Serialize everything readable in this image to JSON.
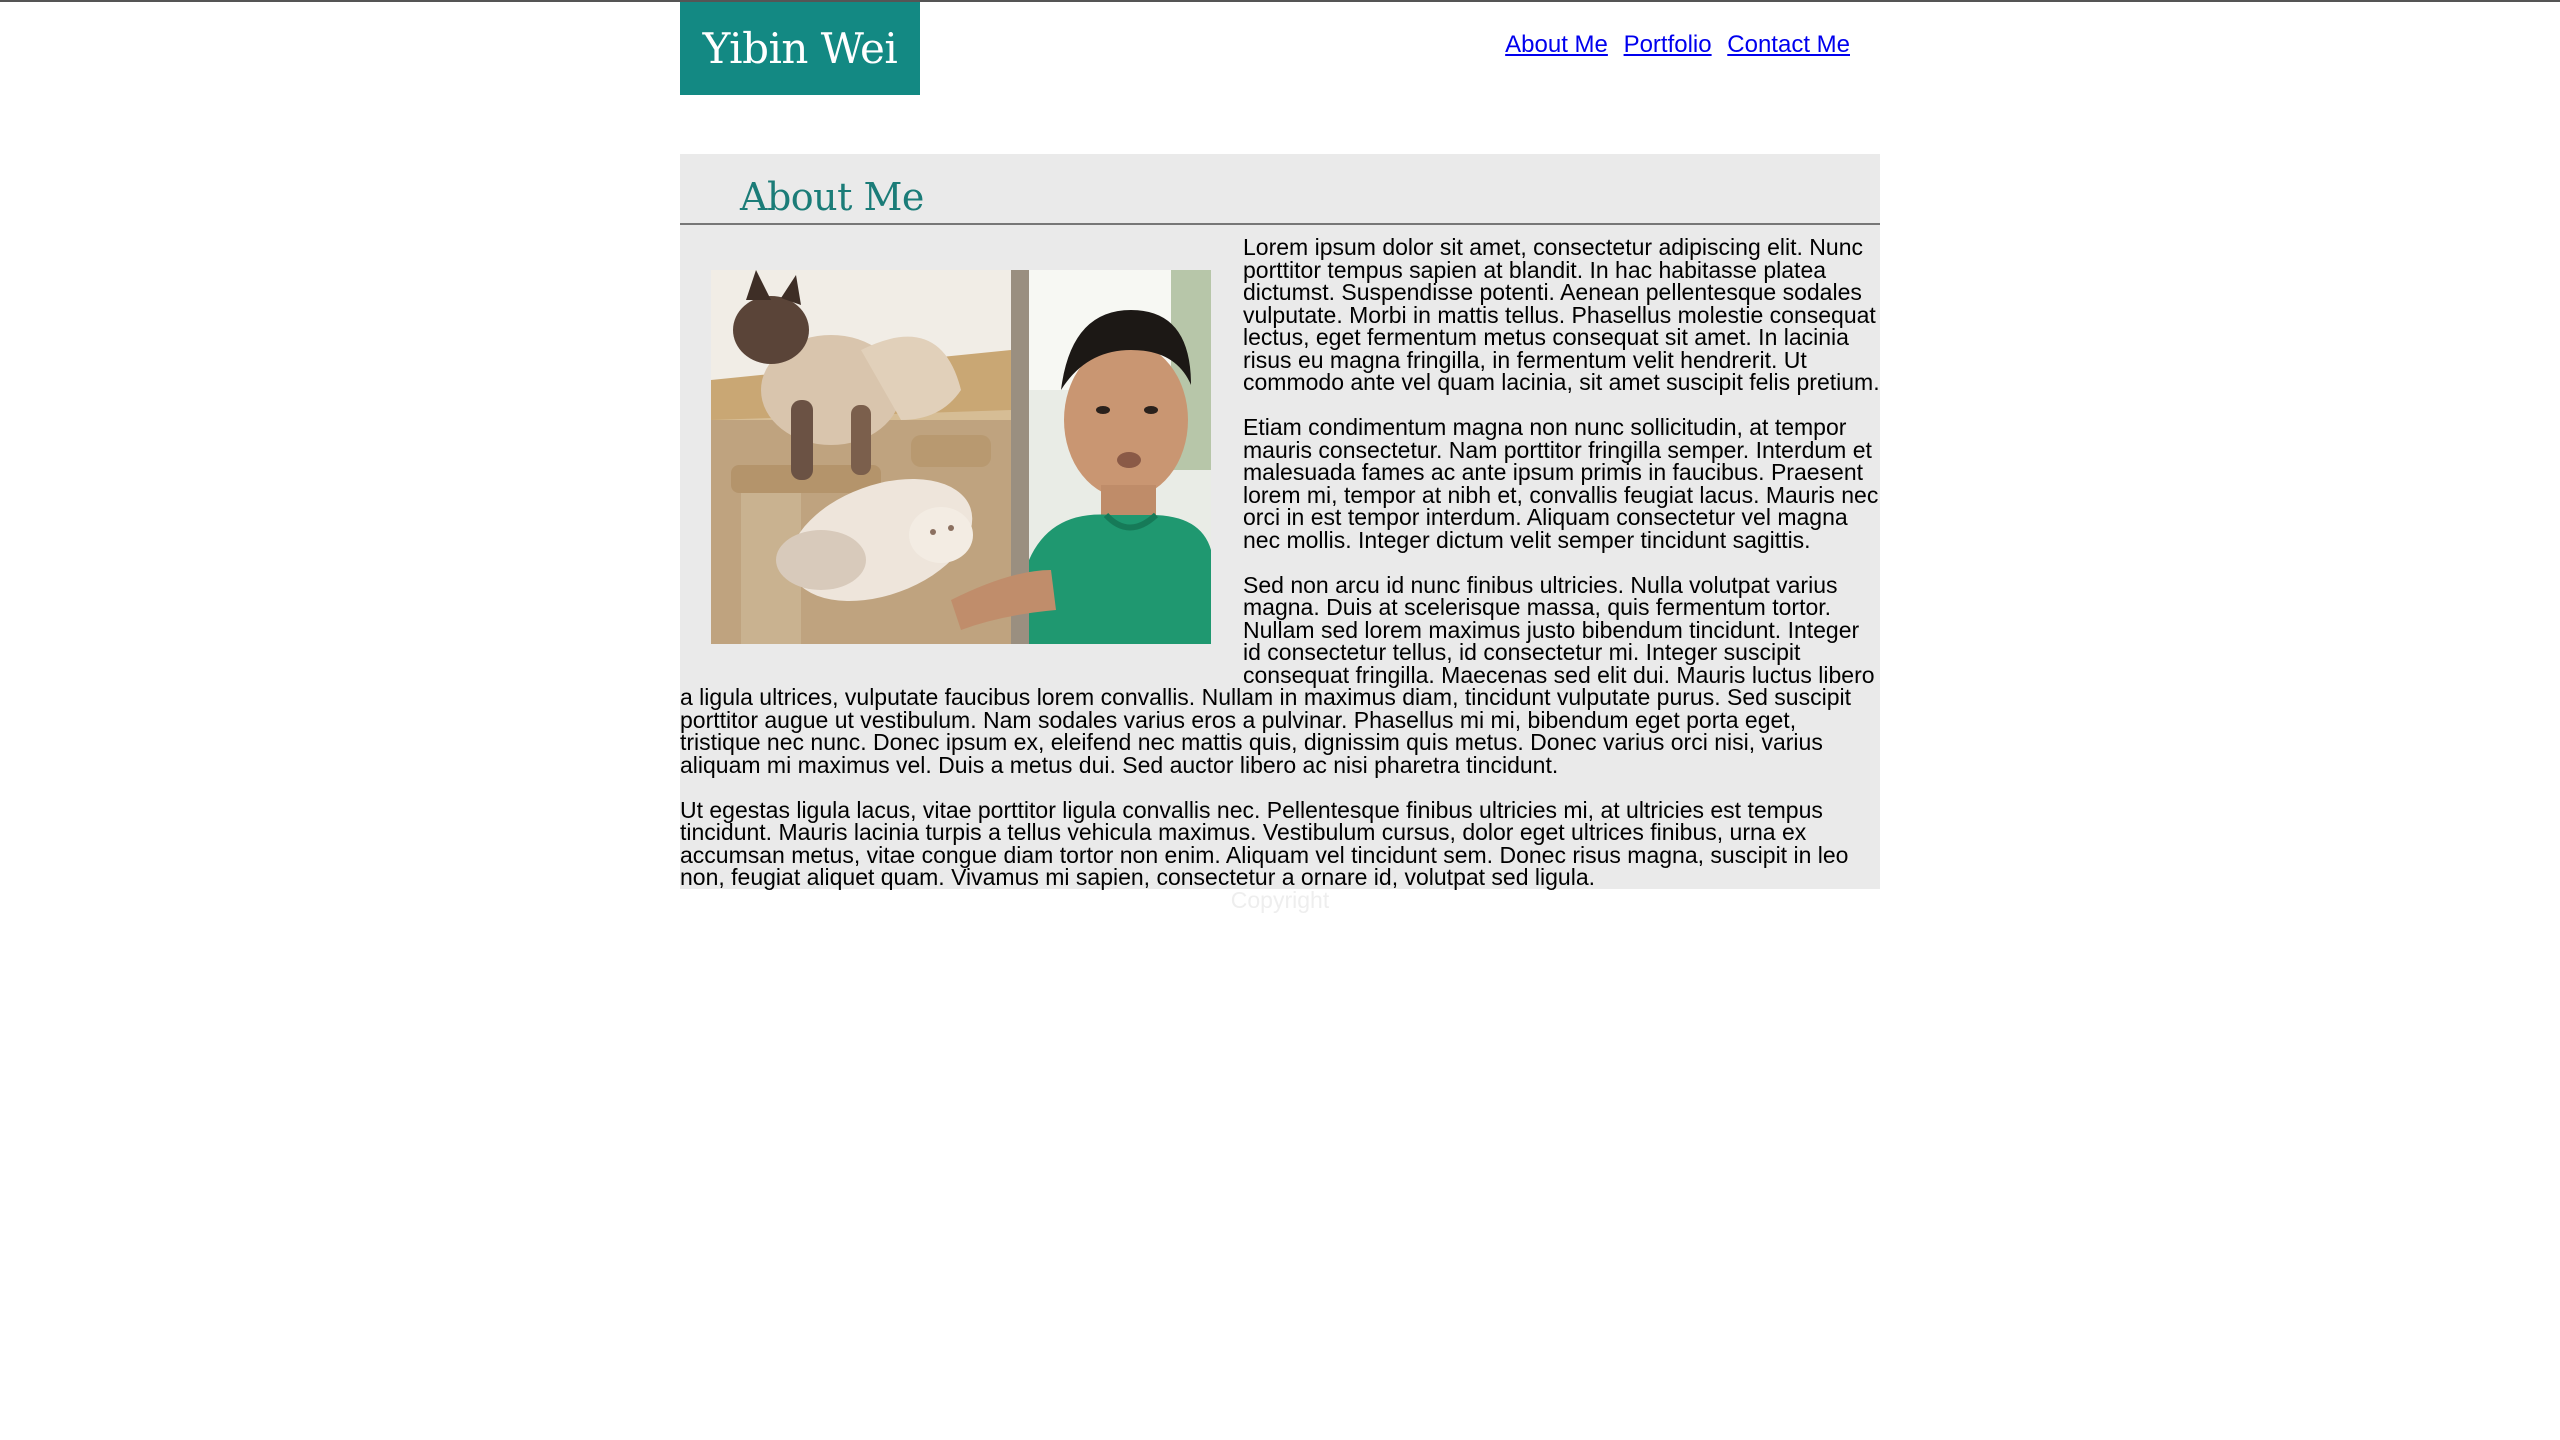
{
  "site": {
    "brand": "Yibin Wei"
  },
  "nav": {
    "items": [
      "About Me",
      "Portfolio",
      "Contact Me"
    ]
  },
  "about": {
    "title": "About Me",
    "paragraphs": [
      "Lorem ipsum dolor sit amet, consectetur adipiscing elit. Nunc porttitor tempus sapien at blandit. In hac habitasse platea dictumst. Suspendisse potenti. Aenean pellentesque sodales vulputate. Morbi in mattis tellus. Phasellus molestie consequat lectus, eget fermentum metus consequat sit amet. In lacinia risus eu magna fringilla, in fermentum velit hendrerit. Ut commodo ante vel quam lacinia, sit amet suscipit felis pretium.",
      "Etiam condimentum magna non nunc sollicitudin, at tempor mauris consectetur. Nam porttitor fringilla semper. Interdum et malesuada fames ac ante ipsum primis in faucibus. Praesent lorem mi, tempor at nibh et, convallis feugiat lacus. Mauris nec orci in est tempor interdum. Aliquam consectetur vel magna nec mollis. Integer dictum velit semper tincidunt sagittis.",
      "Sed non arcu id nunc finibus ultricies. Nulla volutpat varius magna. Duis at scelerisque massa, quis fermentum tortor. Nullam sed lorem maximus justo bibendum tincidunt. Integer id consectetur tellus, id consectetur mi. Integer suscipit consequat fringilla. Maecenas sed elit dui. Mauris luctus libero a ligula ultrices, vulputate faucibus lorem convallis. Nullam in maximus diam, tincidunt vulputate purus. Sed suscipit porttitor augue ut vestibulum. Nam sodales varius eros a pulvinar. Phasellus mi mi, bibendum eget porta eget, tristique nec nunc. Donec ipsum ex, eleifend nec mattis quis, dignissim quis metus. Donec varius orci nisi, varius aliquam mi maximus vel. Duis a metus dui. Sed auctor libero ac nisi pharetra tincidunt.",
      "Ut egestas ligula lacus, vitae porttitor ligula convallis nec. Pellentesque finibus ultricies mi, at ultricies est tempus tincidunt. Mauris lacinia turpis a tellus vehicula maximus. Vestibulum cursus, dolor eget ultrices finibus, urna ex accumsan metus, vitae congue diam tortor non enim. Aliquam vel tincidunt sem. Donec risus magna, suscipit in leo non, feugiat aliquet quam. Vivamus mi sapien, consectetur a ornare id, volutpat sed ligula."
    ]
  },
  "footer": {
    "copyright": "Copyright"
  },
  "colors": {
    "brand_bg": "#138983",
    "title_text": "#1b7c78",
    "content_bg": "#eaeaea",
    "link": "#0000ee"
  }
}
